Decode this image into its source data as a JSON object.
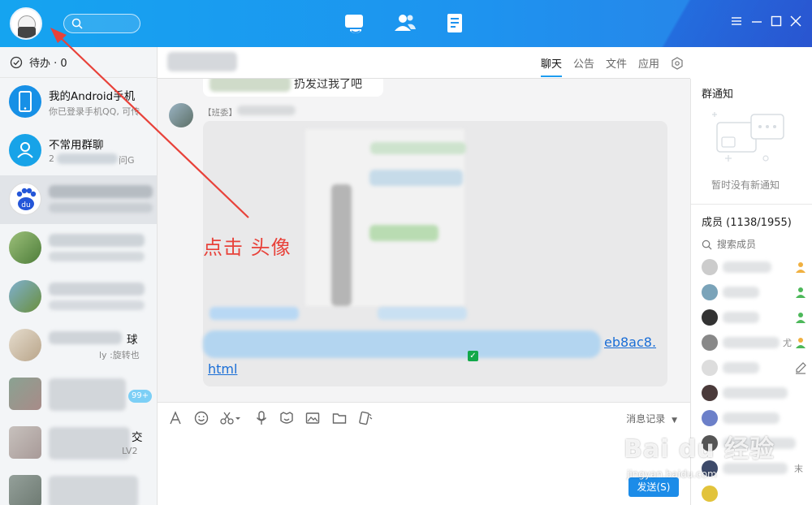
{
  "topbar": {
    "nav_icons": [
      "chat-icon",
      "contacts-icon",
      "files-icon"
    ],
    "window_controls": [
      "menu-icon",
      "minimize-icon",
      "maximize-icon",
      "close-icon"
    ]
  },
  "sidebar": {
    "todo_label": "待办 · 0",
    "items": [
      {
        "name": "我的Android手机",
        "preview": "你已登录手机QQ, 可传",
        "icon": "phone-icon"
      },
      {
        "name": "不常用群聊",
        "preview": "2",
        "tag": "问G",
        "icon": "group-icon"
      },
      {
        "name": "",
        "preview": "",
        "icon": "baidu-paw-icon"
      },
      {
        "name": "",
        "preview": "",
        "tag": "",
        "icon": "avatar"
      },
      {
        "name": "",
        "preview": "",
        "icon": "avatar"
      },
      {
        "name": "球",
        "preview": "ly :旋转也",
        "icon": "avatar"
      },
      {
        "name": "",
        "preview": "",
        "badge": "99+",
        "icon": "avatar"
      },
      {
        "name": "交",
        "preview": "LV2",
        "icon": "avatar"
      },
      {
        "name": "",
        "preview": "",
        "icon": "avatar"
      }
    ]
  },
  "chat": {
    "tabs": [
      "聊天",
      "公告",
      "文件",
      "应用"
    ],
    "active_tab": "聊天",
    "top_message_snippet": "扔发过我了吧",
    "sender_tag": "【班委】",
    "link_tail": "eb8ac8.",
    "link_end": "html",
    "toolbar_icons": [
      "font-icon",
      "emoji-icon",
      "scissors-icon",
      "mic-icon",
      "sticker-icon",
      "image-icon",
      "folder-icon",
      "shake-icon"
    ],
    "message_record_label": "消息记录",
    "send_label": "发送(S)"
  },
  "right_panel": {
    "notice_title": "群通知",
    "notice_empty": "暂时没有新通知",
    "members_title": "成员 (1138/1955)",
    "member_search_placeholder": "搜索成员",
    "member_extra_text": "尤",
    "member_extra_text2": "末"
  },
  "annotation": {
    "text": "点击  头像",
    "color": "#e8423a"
  },
  "watermark": {
    "line1": "Bai du 经验",
    "line2": "jingyan.baidu.com"
  },
  "colors": {
    "topbar": "#1e93ef",
    "accent": "#1e9df0",
    "link": "#1a6ed6",
    "annotation": "#e8423a"
  }
}
